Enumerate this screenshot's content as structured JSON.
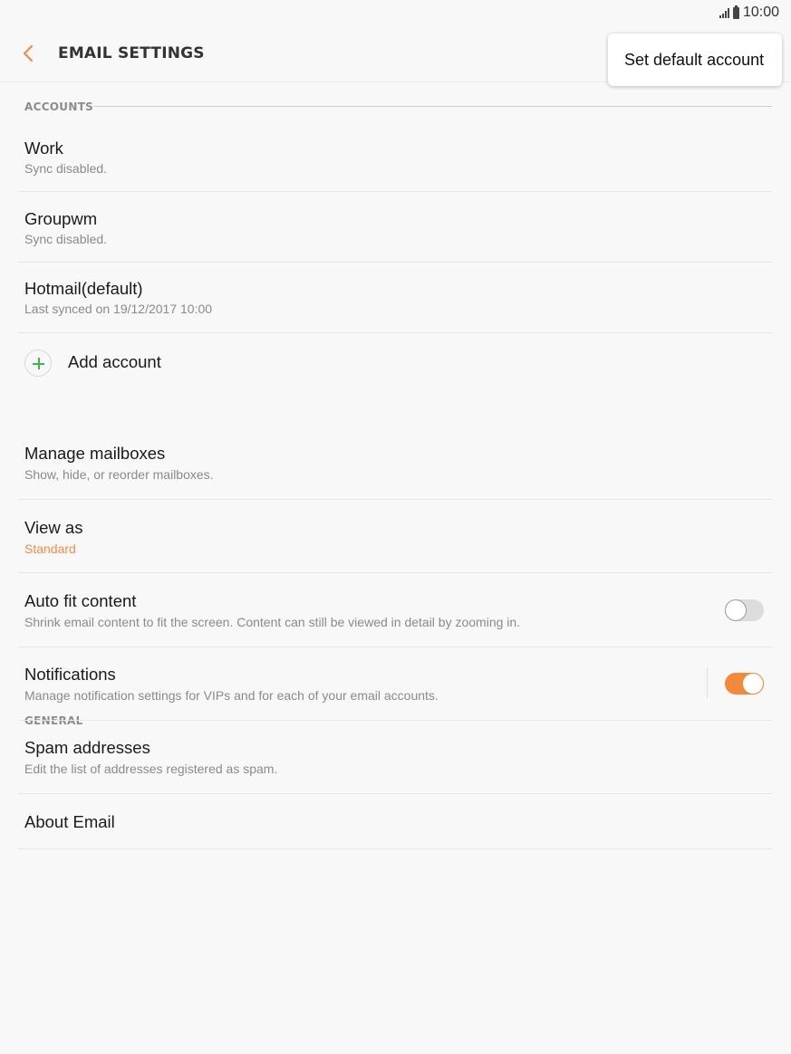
{
  "status_bar": {
    "time": "10:00",
    "icons": [
      "signal-icon",
      "battery-icon"
    ]
  },
  "header": {
    "back_icon": "chevron-left-icon",
    "title": "EMAIL SETTINGS"
  },
  "popup_menu": {
    "items": [
      {
        "label": "Set default account"
      }
    ]
  },
  "sections": {
    "accounts": {
      "label": "ACCOUNTS",
      "items": [
        {
          "title": "Work",
          "subtitle": "Sync disabled."
        },
        {
          "title": "Groupwm",
          "subtitle": "Sync disabled."
        },
        {
          "title": "Hotmail(default)",
          "subtitle": "Last synced on 19/12/2017  10:00"
        }
      ],
      "add_account": {
        "label": "Add account",
        "icon": "plus-icon"
      }
    },
    "general": {
      "label": "GENERAL",
      "items": [
        {
          "title": "Manage mailboxes",
          "subtitle": "Show, hide, or reorder mailboxes."
        },
        {
          "title": "View as",
          "subtitle": "Standard"
        },
        {
          "title": "Auto fit content",
          "subtitle": "Shrink email content to fit the screen. Content can still be viewed in detail by zooming in.",
          "toggle": "off"
        },
        {
          "title": "Notifications",
          "subtitle": "Manage notification settings for VIPs and for each of your email accounts.",
          "toggle": "on"
        },
        {
          "title": "Spam addresses",
          "subtitle": "Edit the list of addresses registered as spam."
        },
        {
          "title": "About Email"
        }
      ]
    }
  },
  "colors": {
    "accent": "#f28a3c",
    "add_icon": "#3cb54a",
    "background": "#f8f8f8"
  }
}
